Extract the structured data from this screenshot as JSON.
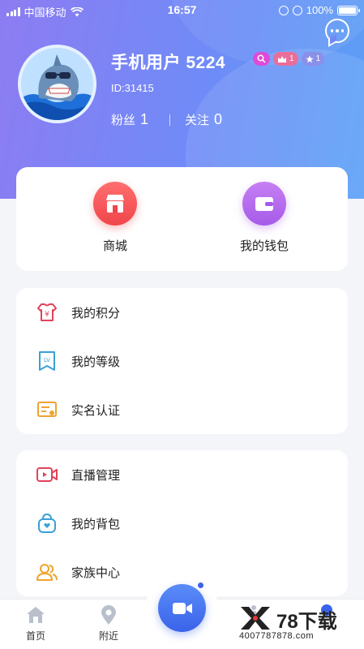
{
  "status_bar": {
    "carrier": "中国移动",
    "time": "16:57",
    "battery": "100%"
  },
  "profile": {
    "username": "手机用户 5224",
    "user_id": "ID:31415",
    "badges": {
      "crown_level": "1",
      "star_level": "1"
    },
    "fans_label": "粉丝",
    "fans_count": "1",
    "follow_label": "关注",
    "follow_count": "0"
  },
  "quick_actions": [
    {
      "label": "商城",
      "icon": "store-icon"
    },
    {
      "label": "我的钱包",
      "icon": "wallet-icon"
    }
  ],
  "menu_group_1": [
    {
      "label": "我的积分",
      "icon": "points-icon"
    },
    {
      "label": "我的等级",
      "icon": "level-icon"
    },
    {
      "label": "实名认证",
      "icon": "id-card-icon"
    }
  ],
  "menu_group_2": [
    {
      "label": "直播管理",
      "icon": "live-video-icon"
    },
    {
      "label": "我的背包",
      "icon": "backpack-icon"
    },
    {
      "label": "家族中心",
      "icon": "family-icon"
    }
  ],
  "tab_bar": {
    "tabs": [
      {
        "label": "首页",
        "icon": "home-icon"
      },
      {
        "label": "附近",
        "icon": "location-icon"
      }
    ],
    "center_icon": "video-camera-icon"
  },
  "watermark": {
    "brand": "78下载",
    "phone": "4007787878.com"
  },
  "colors": {
    "header_start": "#8d7cf2",
    "header_end": "#5aa0f6",
    "accent_blue": "#3a63ea",
    "store_red": "#f0454a",
    "wallet_purple": "#a65be8"
  }
}
